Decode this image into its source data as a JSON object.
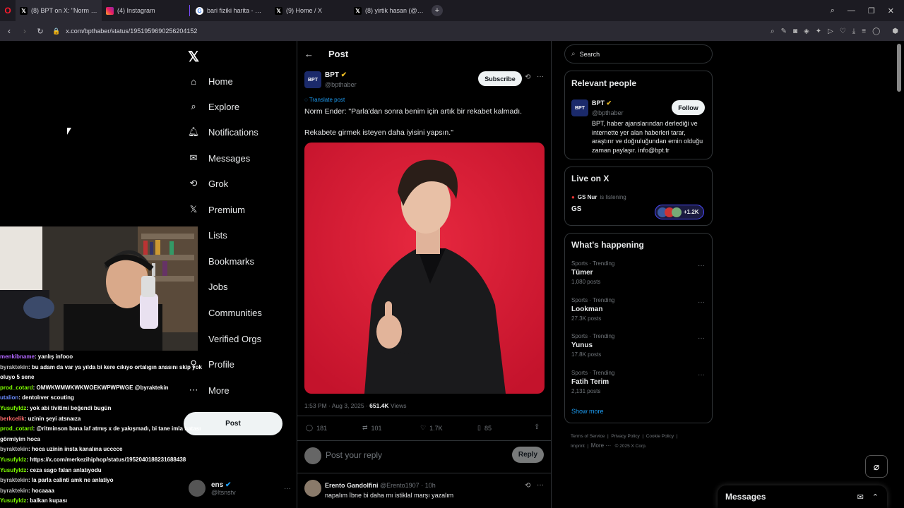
{
  "browser": {
    "tabs": [
      {
        "title": "(8) BPT on X: \"Norm Ender",
        "icon": "x-logo",
        "active": true
      },
      {
        "title": "(4) Instagram",
        "icon": "instagram-logo",
        "active": false
      },
      {
        "title": "bari fiziki harita - Google",
        "icon": "google-logo",
        "active": false
      },
      {
        "title": "(9) Home / X",
        "icon": "x-logo",
        "active": false
      },
      {
        "title": "(8) yirtik hasan (@yirtikyo",
        "icon": "x-logo",
        "active": false
      }
    ],
    "url": "x.com/bpthaber/status/1951959690256204152"
  },
  "nav": {
    "items": [
      {
        "label": "Home",
        "icon": "home-icon"
      },
      {
        "label": "Explore",
        "icon": "search-icon"
      },
      {
        "label": "Notifications",
        "icon": "bell-icon"
      },
      {
        "label": "Messages",
        "icon": "mail-icon"
      },
      {
        "label": "Grok",
        "icon": "grok-icon"
      },
      {
        "label": "Premium",
        "icon": "x-logo-icon"
      },
      {
        "label": "Lists",
        "icon": "list-icon"
      },
      {
        "label": "Bookmarks",
        "icon": "bookmark-icon"
      },
      {
        "label": "Jobs",
        "icon": "briefcase-icon"
      },
      {
        "label": "Communities",
        "icon": "people-icon"
      },
      {
        "label": "Verified Orgs",
        "icon": "lightning-icon"
      },
      {
        "label": "Profile",
        "icon": "person-icon"
      },
      {
        "label": "More",
        "icon": "more-circle-icon"
      }
    ],
    "post_button": "Post",
    "account": {
      "name": "ens",
      "handle": "@ltsnstv"
    }
  },
  "chat": [
    {
      "user": "menkibname",
      "text": ": yanlış infooo",
      "color": "#b266ff"
    },
    {
      "user": "byraktekin",
      "text": ": bu adam da var ya yılda bi kere cıkıyo ortalıgın anasını skip yok oluyo 5 sene",
      "color": "#bdbdbd"
    },
    {
      "user": "prod_cotard",
      "text": ": OMWKWMWKWKWOEKWPWPWGE @byraktekin",
      "color": "#7fff00"
    },
    {
      "user": "utalion",
      "text": ": dentolıver scouting",
      "color": "#6a8cff"
    },
    {
      "user": "Yusufyldz",
      "text": ": yok abi tivitimi beğendi bugün",
      "color": "#7fff00"
    },
    {
      "user": "berkcelik",
      "text": ": uzinin şeyi atsnaıza",
      "color": "#ff6b6b"
    },
    {
      "user": "prod_cotard",
      "text": ": @ritminson bana laf atmış x de yakışmadı, bi tane imla hatası görmiyim hoca",
      "color": "#7fff00"
    },
    {
      "user": "byraktekin",
      "text": ": hoca uzinin insta kanalına ucccce",
      "color": "#bdbdbd"
    },
    {
      "user": "Yusufyldz",
      "text": ": https://x.com/merkezihiphop/status/1952040188231688438",
      "color": "#7fff00"
    },
    {
      "user": "Yusufyldz",
      "text": ": ceza sago falan anlatıyodu",
      "color": "#7fff00"
    },
    {
      "user": "byraktekin",
      "text": ": la parla calinti amk ne anlatiyo",
      "color": "#bdbdbd"
    },
    {
      "user": "byraktekin",
      "text": ": hocaaaa",
      "color": "#bdbdbd"
    },
    {
      "user": "Yusufyldz",
      "text": ": balkan kupası",
      "color": "#7fff00"
    }
  ],
  "post": {
    "header_title": "Post",
    "author": {
      "name": "BPT",
      "handle": "@bpthaber"
    },
    "subscribe": "Subscribe",
    "translate": "Translate post",
    "text_line1": "Norm Ender: \"Parla'dan sonra benim için artık bir rekabet kalmadı.",
    "text_line2": "Rekabete girmek isteyen daha iyisini yapsın.\"",
    "time": "1:53 PM · Aug 3, 2025 ·",
    "views_count": "651.4K",
    "views_label": "Views",
    "stats": {
      "replies": "181",
      "reposts": "101",
      "likes": "1.7K",
      "bookmarks": "85"
    },
    "reply_placeholder": "Post your reply",
    "reply_button": "Reply"
  },
  "reply": {
    "name": "Erento Gandolfini",
    "handle": "@Erento1907 · 10h",
    "text": "napalım İbne bi daha mı istiklal marşı yazalım"
  },
  "search": {
    "placeholder": "Search"
  },
  "relevant": {
    "title": "Relevant people",
    "name": "BPT",
    "handle": "@bpthaber",
    "follow": "Follow",
    "bio": "BPT, haber ajanslarından derlediği ve internette yer alan haberleri tarar, araştırır ve doğruluğundan emin olduğu zaman paylaşır. info@bpt.tr"
  },
  "live": {
    "title": "Live on X",
    "host": "GS Nur",
    "status": "is listening",
    "space": "GS",
    "count": "+1.2K"
  },
  "happening": {
    "title": "What's happening",
    "trends": [
      {
        "category": "Sports · Trending",
        "name": "Tümer",
        "posts": "1,080 posts"
      },
      {
        "category": "Sports · Trending",
        "name": "Lookman",
        "posts": "27.3K posts"
      },
      {
        "category": "Sports · Trending",
        "name": "Yunus",
        "posts": "17.8K posts"
      },
      {
        "category": "Sports · Trending",
        "name": "Fatih Terim",
        "posts": "2,131 posts"
      }
    ],
    "show_more": "Show more"
  },
  "footer": {
    "links": [
      "Terms of Service",
      "Privacy Policy",
      "Cookie Policy",
      "Imprint",
      "More ···",
      "© 2025 X Corp."
    ]
  },
  "messages_dock": {
    "title": "Messages"
  },
  "colors": {
    "accent": "#1d9bf0",
    "post_image_bg": "#d81f3c",
    "background": "#000000",
    "border": "#2f3336"
  }
}
